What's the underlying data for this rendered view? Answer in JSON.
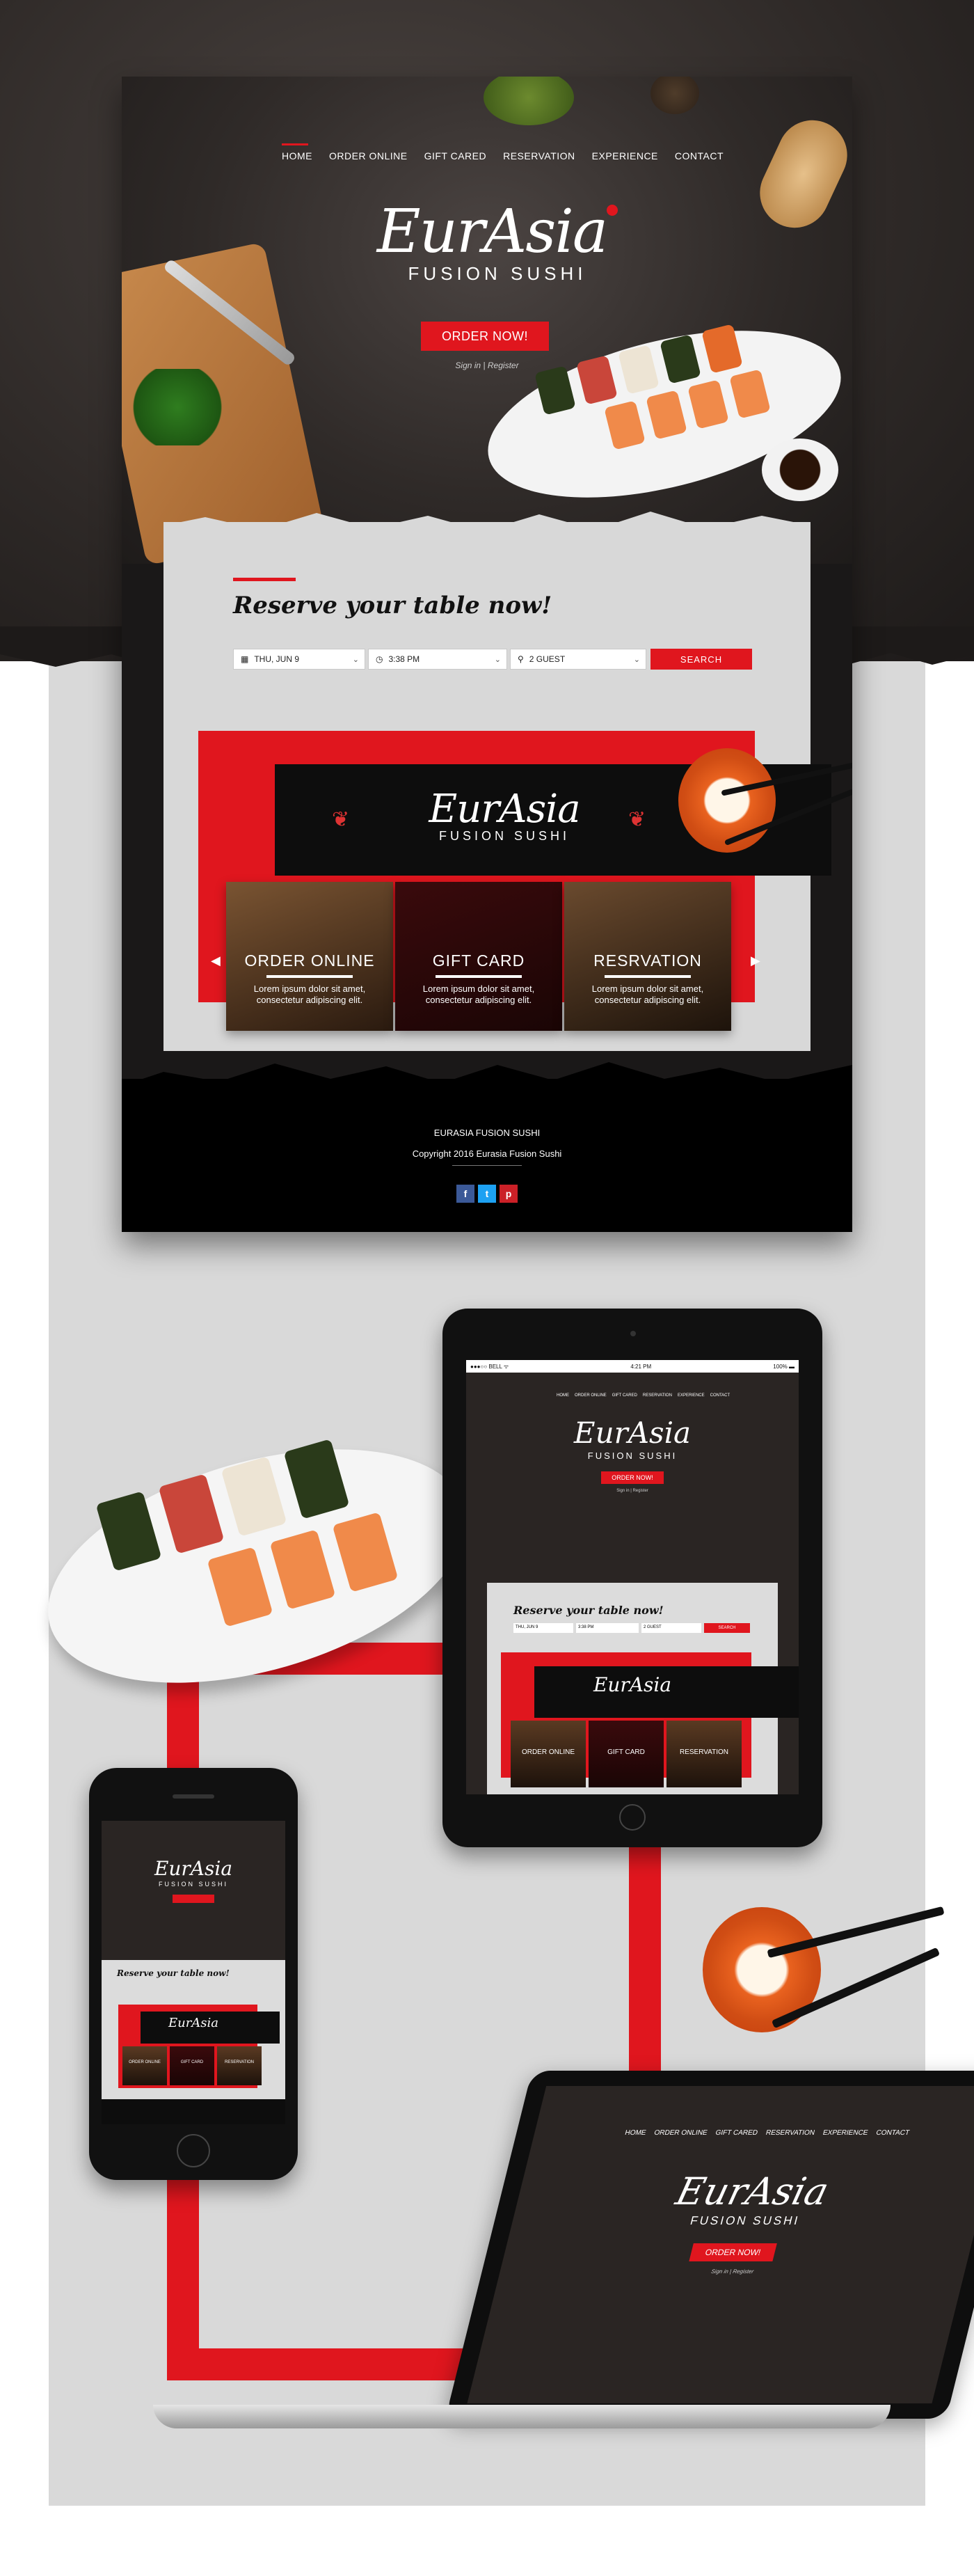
{
  "nav": {
    "items": [
      "HOME",
      "ORDER ONLINE",
      "GIFT CARED",
      "RESERVATION",
      "EXPERIENCE",
      "CONTACT"
    ]
  },
  "hero": {
    "logo_name": "EurAsia",
    "logo_sub": "FUSION SUSHI",
    "order_button": "ORDER NOW!",
    "signin_text": "Sign in | Register"
  },
  "reservation": {
    "title": "Reserve your table now!",
    "date": "THU, JUN 9",
    "time": "3:38 PM",
    "guests": "2 GUEST",
    "search_button": "SEARCH"
  },
  "banner": {
    "logo_name": "EurAsia",
    "logo_sub": "FUSION SUSHI"
  },
  "cards": [
    {
      "title": "ORDER ONLINE",
      "desc_line1": "Lorem ipsum dolor sit amet,",
      "desc_line2": "consectetur adipiscing elit."
    },
    {
      "title": "GIFT CARD",
      "desc_line1": "Lorem ipsum dolor sit amet,",
      "desc_line2": "consectetur adipiscing elit."
    },
    {
      "title": "RESRVATION",
      "desc_line1": "Lorem ipsum dolor sit amet,",
      "desc_line2": "consectetur adipiscing elit."
    }
  ],
  "footer": {
    "name": "EURASIA FUSION SUSHI",
    "copyright": "Copyright 2016 Eurasia Fusion Sushi",
    "social": [
      "f",
      "t",
      "p"
    ]
  },
  "tablet": {
    "status_left": "●●●○○ BELL ᯤ",
    "status_time": "4:21 PM",
    "status_right": "100% ▬",
    "nav": [
      "HOME",
      "ORDER ONLINE",
      "GIFT CARED",
      "RESERVATION",
      "EXPERIENCE",
      "CONTACT"
    ],
    "logo_name": "EurAsia",
    "logo_sub": "FUSION SUSHI",
    "order_button": "ORDER NOW!",
    "signin_text": "Sign in | Register",
    "reserve_title": "Reserve your table now!",
    "date": "THU, JUN 9",
    "time": "3:38 PM",
    "guests": "2 GUEST",
    "search": "SEARCH",
    "cards": [
      "ORDER ONLINE",
      "GIFT CARD",
      "RESERVATION"
    ]
  },
  "phone": {
    "logo_name": "EurAsia",
    "logo_sub": "FUSION SUSHI",
    "reserve_title": "Reserve your table now!",
    "cards": [
      "ORDER ONLINE",
      "GIFT CARD",
      "RESERVATION"
    ]
  },
  "laptop": {
    "nav": [
      "HOME",
      "ORDER ONLINE",
      "GIFT CARED",
      "RESERVATION",
      "EXPERIENCE",
      "CONTACT"
    ],
    "logo_name": "EurAsia",
    "logo_sub": "FUSION SUSHI",
    "order_button": "ORDER NOW!",
    "signin_text": "Sign in | Register"
  },
  "colors": {
    "accent": "#e0161e",
    "dark": "#2e2927",
    "light": "#d9d9d9"
  }
}
